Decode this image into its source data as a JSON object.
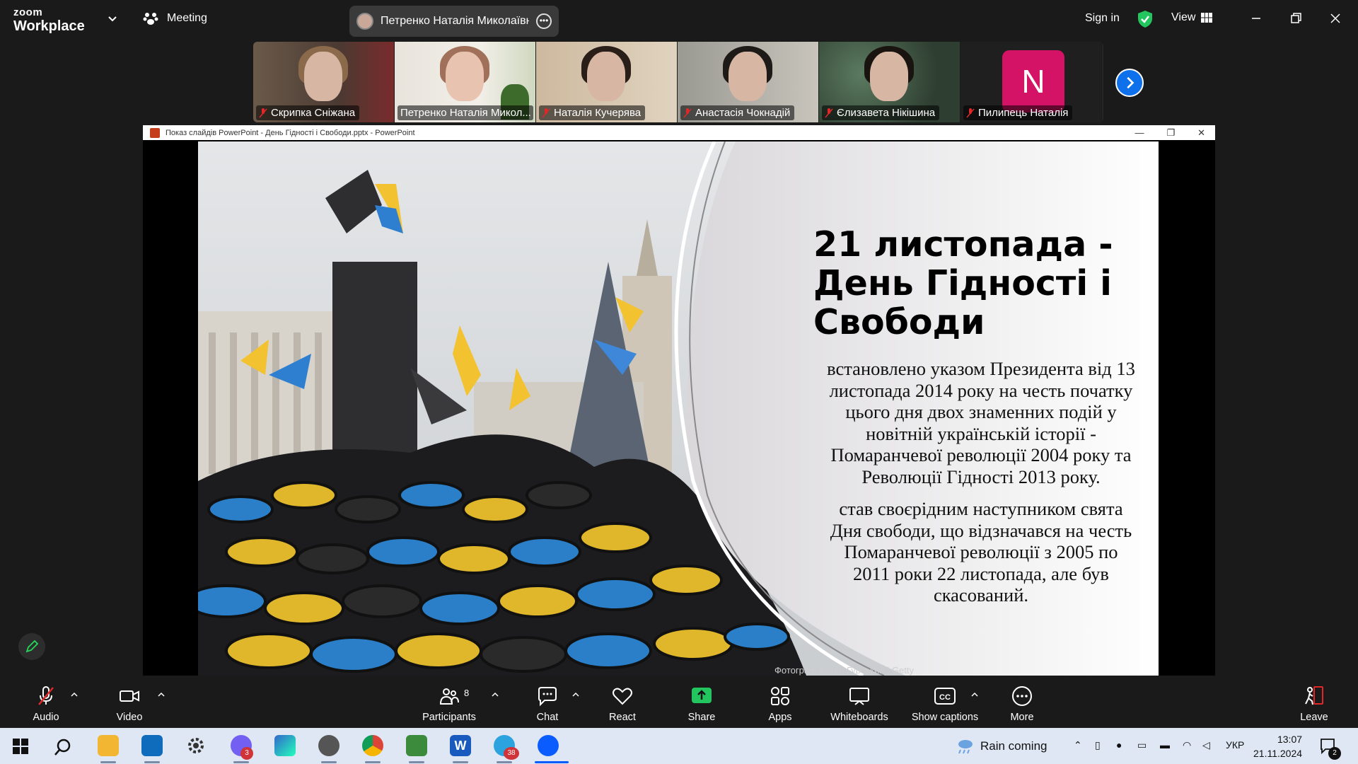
{
  "app": {
    "logo_small": "zoom",
    "logo_big": "Workplace",
    "meeting_label": "Meeting",
    "active_speaker": "Петренко Наталія Миколаївна'",
    "signin_label": "Sign in",
    "view_label": "View"
  },
  "participants": [
    {
      "name": "Скрипка Сніжана",
      "muted": true,
      "active": false
    },
    {
      "name": "Петренко Наталія Микол...",
      "muted": false,
      "active": true
    },
    {
      "name": "Наталія Кучерява",
      "muted": true,
      "active": false
    },
    {
      "name": "Анастасія Чокнадій",
      "muted": true,
      "active": false
    },
    {
      "name": "Єлизавета Нікішина",
      "muted": true,
      "active": false
    },
    {
      "name": "Пилипець Наталія",
      "muted": true,
      "active": false,
      "initial": "N"
    }
  ],
  "ppt": {
    "window_title": "Показ слайдів PowerPoint  -  День Гідності і Свободи.pptx - PowerPoint",
    "slide": {
      "title": "21 листопада - День Гідності і Свободи",
      "paragraph1": "встановлено указом Президента від 13 листопада 2014 року на честь початку цього дня двох знаменних подій у новітній українській історії - Помаранчевої революції 2004 року та Революції Гідності 2013 року.",
      "paragraph2": "став своєрідним наступником свята Дня свободи, що відзначався на честь Помаранчевої революції з 2005 по 2011 роки 22 листопада, але був скасований.",
      "photo_credit": "Фотограф Євген Гурський | Getty"
    }
  },
  "toolbar": {
    "audio": "Audio",
    "video": "Video",
    "participants": "Participants",
    "participants_count": "8",
    "chat": "Chat",
    "react": "React",
    "share": "Share",
    "apps": "Apps",
    "whiteboards": "Whiteboards",
    "captions": "Show captions",
    "more": "More",
    "leave": "Leave"
  },
  "taskbar": {
    "weather": "Rain coming",
    "language": "УКР",
    "time": "13:07",
    "date": "21.11.2024",
    "notif_count": "2",
    "viber_badge": "3",
    "telegram_badge": "38"
  },
  "colors": {
    "zoom_blue": "#0e71eb",
    "active_green": "#23d959",
    "share_green": "#23c55e",
    "leave_red": "#e02828"
  }
}
